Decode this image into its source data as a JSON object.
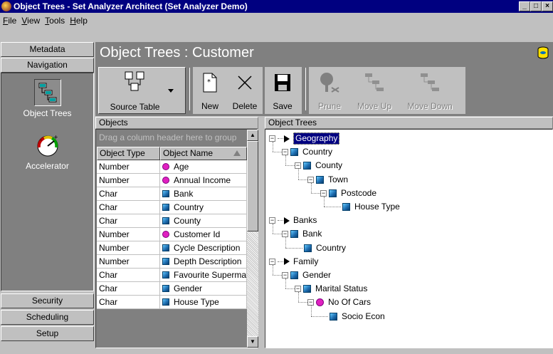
{
  "window": {
    "title": "Object Trees - Set Analyzer Architect (Set Analyzer Demo)"
  },
  "menu": [
    "File",
    "View",
    "Tools",
    "Help"
  ],
  "menu_mnemonics": [
    "F",
    "V",
    "T",
    "H"
  ],
  "nav": {
    "top_buttons": [
      "Metadata",
      "Navigation"
    ],
    "items": [
      {
        "label": "Object Trees",
        "icon": "object-trees-icon",
        "selected": true
      },
      {
        "label": "Accelerator",
        "icon": "gauge-icon",
        "selected": false
      }
    ],
    "bottom_buttons": [
      "Security",
      "Scheduling",
      "Setup"
    ]
  },
  "header": {
    "title": "Object Trees : Customer"
  },
  "toolbar": {
    "source_table": "Source Table",
    "new": "New",
    "delete": "Delete",
    "save": "Save",
    "prune": "Prune",
    "move_up": "Move Up",
    "move_down": "Move Down"
  },
  "objects": {
    "header": "Objects",
    "group_hint": "Drag a column header here to group",
    "columns": [
      "Object Type",
      "Object Name"
    ],
    "rows": [
      {
        "type": "Number",
        "name": "Age",
        "icon": "dot"
      },
      {
        "type": "Number",
        "name": "Annual Income",
        "icon": "dot"
      },
      {
        "type": "Char",
        "name": "Bank",
        "icon": "cube"
      },
      {
        "type": "Char",
        "name": "Country",
        "icon": "cube"
      },
      {
        "type": "Char",
        "name": "County",
        "icon": "cube"
      },
      {
        "type": "Number",
        "name": "Customer Id",
        "icon": "dot"
      },
      {
        "type": "Number",
        "name": "Cycle Description",
        "icon": "cube"
      },
      {
        "type": "Number",
        "name": "Depth Description",
        "icon": "cube"
      },
      {
        "type": "Char",
        "name": "Favourite Supermarket",
        "icon": "cube"
      },
      {
        "type": "Char",
        "name": "Gender",
        "icon": "cube"
      },
      {
        "type": "Char",
        "name": "House Type",
        "icon": "cube"
      }
    ]
  },
  "tree": {
    "header": "Object Trees",
    "nodes": [
      {
        "label": "Geography",
        "kind": "root",
        "level": 0,
        "selected": true
      },
      {
        "label": "Country",
        "kind": "cube",
        "level": 1
      },
      {
        "label": "County",
        "kind": "cube",
        "level": 2
      },
      {
        "label": "Town",
        "kind": "cube",
        "level": 3
      },
      {
        "label": "Postcode",
        "kind": "cube",
        "level": 4
      },
      {
        "label": "House Type",
        "kind": "cube",
        "level": 5
      },
      {
        "label": "Banks",
        "kind": "root",
        "level": 0
      },
      {
        "label": "Bank",
        "kind": "cube",
        "level": 1
      },
      {
        "label": "Country",
        "kind": "cube",
        "level": 2
      },
      {
        "label": "Family",
        "kind": "root",
        "level": 0
      },
      {
        "label": "Gender",
        "kind": "cube",
        "level": 1
      },
      {
        "label": "Marital Status",
        "kind": "cube",
        "level": 2
      },
      {
        "label": "No Of Cars",
        "kind": "dot",
        "level": 3
      },
      {
        "label": "Socio Econ",
        "kind": "cube",
        "level": 4
      }
    ]
  }
}
